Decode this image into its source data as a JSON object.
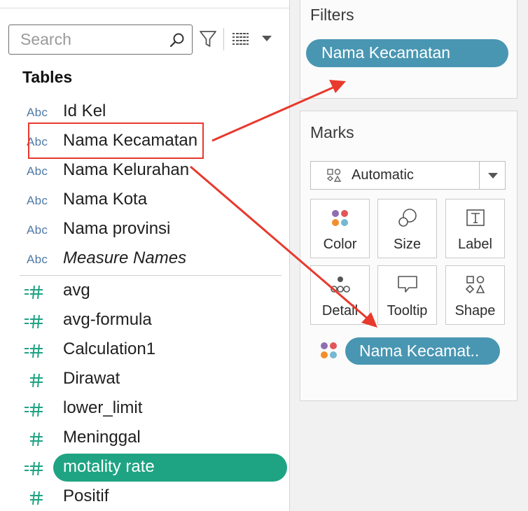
{
  "data_pane": {
    "search": {
      "placeholder": "Search"
    },
    "tables_heading": "Tables",
    "dimensions": [
      {
        "type_badge": "Abc",
        "label": "Id Kel"
      },
      {
        "type_badge": "Abc",
        "label": "Nama Kecamatan"
      },
      {
        "type_badge": "Abc",
        "label": "Nama Kelurahan"
      },
      {
        "type_badge": "Abc",
        "label": "Nama Kota"
      },
      {
        "type_badge": "Abc",
        "label": "Nama provinsi"
      },
      {
        "type_badge": "Abc",
        "label": "Measure Names"
      }
    ],
    "measures": [
      {
        "icon": "calculated-measure-icon",
        "label": "avg"
      },
      {
        "icon": "calculated-measure-icon",
        "label": "avg-formula"
      },
      {
        "icon": "calculated-measure-icon",
        "label": "Calculation1"
      },
      {
        "icon": "measure-icon",
        "label": "Dirawat"
      },
      {
        "icon": "calculated-measure-icon",
        "label": "lower_limit"
      },
      {
        "icon": "measure-icon",
        "label": "Meninggal"
      },
      {
        "icon": "calculated-measure-icon",
        "label": "motality rate",
        "selected": true
      },
      {
        "icon": "measure-icon",
        "label": "Positif"
      }
    ]
  },
  "filters_card": {
    "title": "Filters",
    "pills": [
      "Nama Kecamatan"
    ]
  },
  "marks_card": {
    "title": "Marks",
    "mark_type": "Automatic",
    "buttons": [
      {
        "label": "Color",
        "icon": "color-dots-icon"
      },
      {
        "label": "Size",
        "icon": "size-circles-icon"
      },
      {
        "label": "Label",
        "icon": "label-text-icon"
      },
      {
        "label": "Detail",
        "icon": "detail-dots-icon"
      },
      {
        "label": "Tooltip",
        "icon": "tooltip-bubble-icon"
      },
      {
        "label": "Shape",
        "icon": "shape-icon"
      }
    ],
    "color_pill": "Nama Kecamat.."
  },
  "colors": {
    "dimension_blue": "#4e79a7",
    "measure_green": "#1fa483",
    "pill_blue": "#4996b2",
    "annotation_red": "#e8392d"
  }
}
